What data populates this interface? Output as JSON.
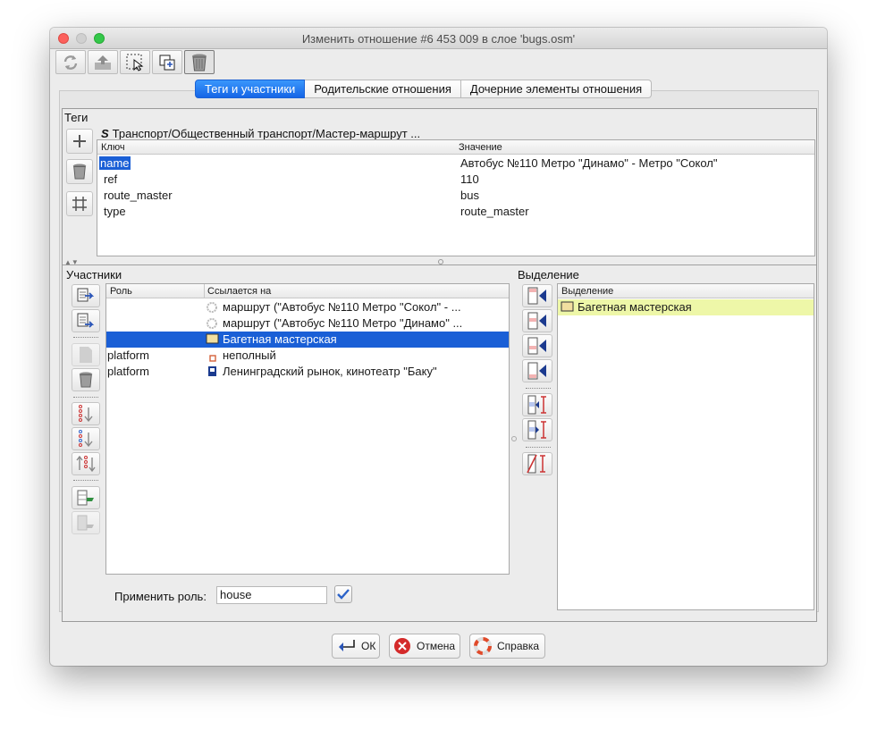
{
  "window": {
    "title": "Изменить отношение #6 453 009 в слое 'bugs.osm'"
  },
  "toolbar": {
    "buttons": [
      "refresh-icon",
      "upload-icon",
      "select-area-icon",
      "duplicate-icon",
      "trash-icon"
    ]
  },
  "tabs": [
    {
      "label": "Теги и участники",
      "active": true
    },
    {
      "label": "Родительские отношения",
      "active": false
    },
    {
      "label": "Дочерние элементы отношения",
      "active": false
    }
  ],
  "tags": {
    "section_label": "Теги",
    "preset_path": "Транспорт/Общественный транспорт/Мастер-маршрут ...",
    "headers": {
      "key": "Ключ",
      "value": "Значение"
    },
    "rows": [
      {
        "key": "name",
        "value": "Автобус №110 Метро \"Динамо\" - Метро \"Сокол\""
      },
      {
        "key": "ref",
        "value": "110"
      },
      {
        "key": "route_master",
        "value": "bus"
      },
      {
        "key": "type",
        "value": "route_master"
      }
    ]
  },
  "members": {
    "section_label": "Участники",
    "headers": {
      "role": "Роль",
      "ref": "Ссылается на"
    },
    "rows": [
      {
        "role": "",
        "ref": "маршрут (\"Автобус №110 Метро \"Сокол\" - ...",
        "icon": "relation-icon"
      },
      {
        "role": "",
        "ref": "маршрут (\"Автобус №110 Метро \"Динамо\" ...",
        "icon": "relation-icon"
      },
      {
        "role": "",
        "ref": "Багетная мастерская",
        "icon": "building-icon",
        "selected": true
      },
      {
        "role": "platform",
        "ref": "неполный",
        "icon": "incomplete-icon"
      },
      {
        "role": "platform",
        "ref": "Ленинградский рынок, кинотеатр \"Баку\"",
        "icon": "bus-stop-icon"
      }
    ],
    "apply_role_label": "Применить роль:",
    "apply_role_value": "house"
  },
  "selection": {
    "section_label": "Выделение",
    "header": "Выделение",
    "rows": [
      {
        "label": "Багетная мастерская",
        "icon": "building-icon"
      }
    ]
  },
  "buttons": {
    "ok": "ОК",
    "cancel": "Отмена",
    "help": "Справка"
  },
  "colors": {
    "selection_blue": "#1a5fd6",
    "selection_yellow": "#eef7a8"
  }
}
